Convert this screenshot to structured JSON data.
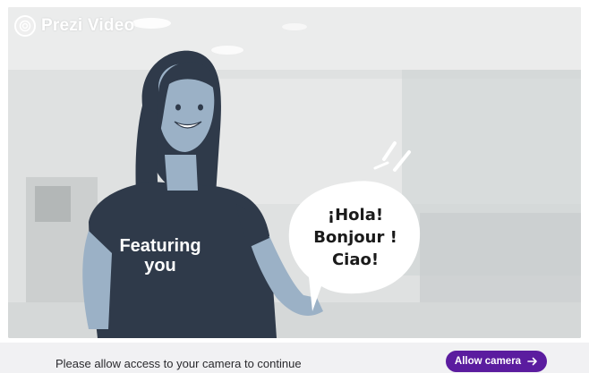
{
  "brand": {
    "name": "Prezi Video",
    "icon": "prezi-logo-icon"
  },
  "illustration": {
    "shirt_text": "Featuring you",
    "speech_lines": [
      "¡Hola!",
      "Bonjour !",
      "Ciao!"
    ]
  },
  "permission_bar": {
    "message": "Please allow access to your camera to continue",
    "button_label": "Allow camera",
    "button_icon": "arrow-right-icon"
  },
  "colors": {
    "accent": "#5b1c9f",
    "character_skin": "#9bb1c6",
    "character_dark": "#2f3a4a",
    "bar_background": "#f1f1f3"
  }
}
